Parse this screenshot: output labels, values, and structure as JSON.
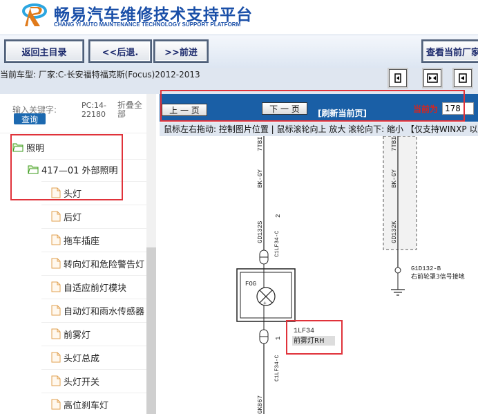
{
  "header": {
    "title_cn": "畅易汽车维修技术支持平台",
    "title_en": "CHANG YI AUTO MAINTENANCE TECHNOLOGY SUPPORT PLATFORM"
  },
  "toolbar": {
    "home": "返回主目录",
    "back": "<<后退.",
    "forward": ">>前进",
    "view_current": "查看当前厂家"
  },
  "car_info": "当前车型:  厂家:C-长安福特福克斯(Focus)2012-2013",
  "left_panel": {
    "keyword_label": "输入关键字:",
    "query_button": "查询",
    "pc_code": "PC:14-22180",
    "fold_all": "折叠全部",
    "tree": [
      {
        "label": "照明",
        "type": "folder"
      },
      {
        "label": "417—01 外部照明",
        "type": "folder"
      },
      {
        "label": "头灯",
        "type": "file"
      },
      {
        "label": "后灯",
        "type": "file"
      },
      {
        "label": "拖车插座",
        "type": "file"
      },
      {
        "label": "转向灯和危险警告灯",
        "type": "file"
      },
      {
        "label": "自适应前灯模块",
        "type": "file"
      },
      {
        "label": "自动灯和雨水传感器",
        "type": "file"
      },
      {
        "label": "前雾灯",
        "type": "file"
      },
      {
        "label": "头灯总成",
        "type": "file"
      },
      {
        "label": "头灯开关",
        "type": "file"
      },
      {
        "label": "高位刹车灯",
        "type": "file"
      }
    ]
  },
  "nav": {
    "prev": "上 一 页",
    "next": "下 一 页",
    "refresh": "[刷新当前页]",
    "current_label": "当前为",
    "current_page": "178"
  },
  "hint": "鼠标左右拖动: 控制图片位置 | 鼠标滚轮向上 放大  滚轮向下: 缩小 【仅支持WINXP 以上",
  "diagram": {
    "wire_top": "7TBI",
    "wire_top2": "7TBI",
    "wire1": "BK-GY",
    "wire2": "BK-GY",
    "connector1": "GD132S",
    "connector1_pin": "2",
    "connector2": "GD132K",
    "connector3": "C1LF34-C",
    "connector3_pin": "2",
    "connector4": "C1LF34-C",
    "connector4_pin": "1",
    "connector5": "C1LF34-C",
    "fog_label": "FOG",
    "ground_id": "G1D132-B",
    "ground_desc": "右前轮罩3信号接地",
    "lamp_id": "1LF34",
    "lamp_name": "前雾灯RH",
    "bottom_wire": "GK867"
  },
  "colors": {
    "brand_blue": "#1a4fa8",
    "nav_blue": "#1a5fa6",
    "highlight_red": "#e0323a"
  }
}
